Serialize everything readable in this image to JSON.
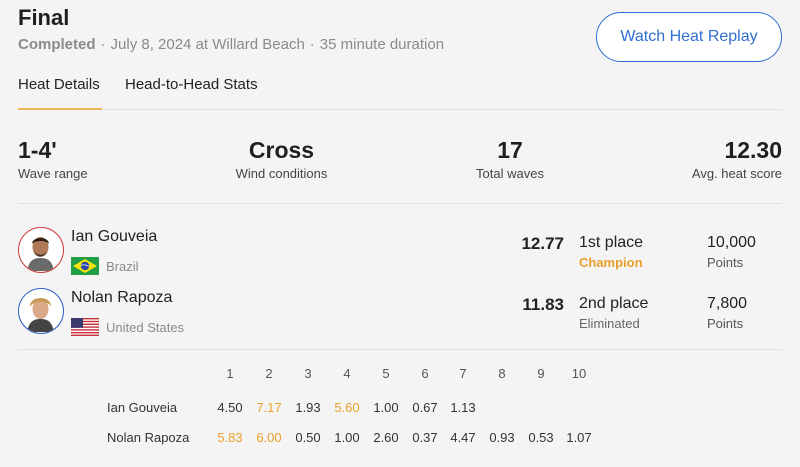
{
  "header": {
    "title": "Final",
    "status": "Completed",
    "date_location": "July 8, 2024 at Willard Beach",
    "duration": "35 minute duration",
    "separator": "·",
    "watch_button": "Watch Heat Replay",
    "accent_color": "#2f6fd1"
  },
  "tabs": [
    {
      "label": "Heat Details",
      "active": true
    },
    {
      "label": "Head-to-Head Stats",
      "active": false
    }
  ],
  "stats": [
    {
      "value": "1-4'",
      "label": "Wave range"
    },
    {
      "value": "Cross",
      "label": "Wind conditions"
    },
    {
      "value": "17",
      "label": "Total waves"
    },
    {
      "value": "12.30",
      "label": "Avg. heat score"
    }
  ],
  "competitors": [
    {
      "name": "Ian Gouveia",
      "country": "Brazil",
      "flag_icon": "brazil-flag-icon",
      "ring_color": "#d23a3a",
      "score": "12.77",
      "place": "1st place",
      "result": "Champion",
      "points": "10,000",
      "points_label": "Points"
    },
    {
      "name": "Nolan Rapoza",
      "country": "United States",
      "flag_icon": "usa-flag-icon",
      "ring_color": "#2f5fc4",
      "score": "11.83",
      "place": "2nd place",
      "result": "Eliminated",
      "points": "7,800",
      "points_label": "Points"
    }
  ],
  "wave_table": {
    "columns": [
      "1",
      "2",
      "3",
      "4",
      "5",
      "6",
      "7",
      "8",
      "9",
      "10"
    ],
    "highlight_color": "#e9a02c",
    "rows": [
      {
        "name": "Ian Gouveia",
        "scores": [
          "4.50",
          "7.17",
          "1.93",
          "5.60",
          "1.00",
          "0.67",
          "1.13"
        ],
        "highlighted": [
          1,
          3
        ]
      },
      {
        "name": "Nolan Rapoza",
        "scores": [
          "5.83",
          "6.00",
          "0.50",
          "1.00",
          "2.60",
          "0.37",
          "4.47",
          "0.93",
          "0.53",
          "1.07"
        ],
        "highlighted": [
          0,
          1
        ]
      }
    ]
  }
}
